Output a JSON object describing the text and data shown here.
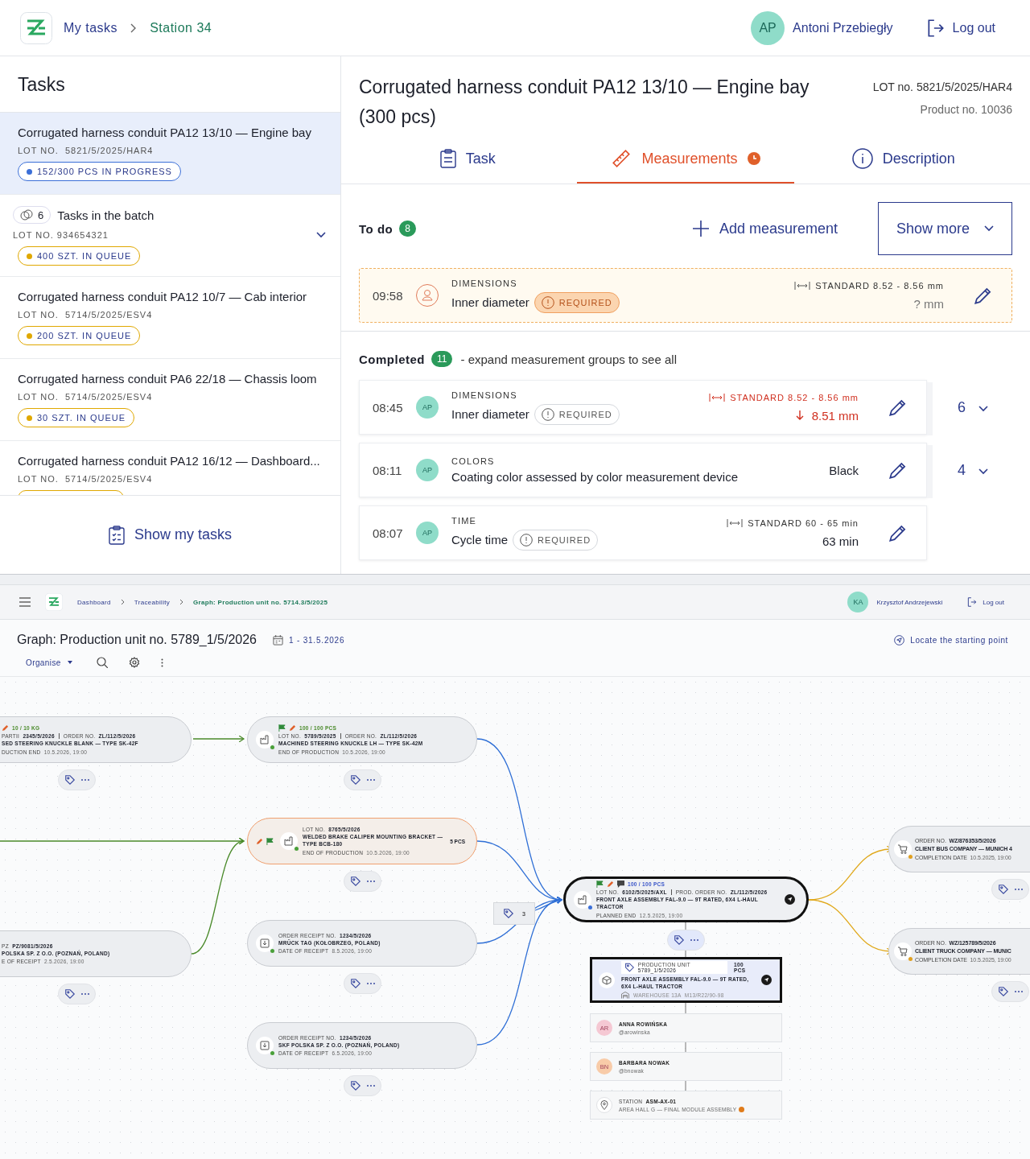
{
  "top": {
    "header": {
      "breadcrumbs": [
        {
          "label": "My tasks",
          "current": false
        },
        {
          "label": "Station 34",
          "current": true
        }
      ],
      "user": {
        "initials": "AP",
        "name": "Antoni Przebiegły"
      },
      "logout": "Log out"
    },
    "tasks_panel": {
      "title": "Tasks",
      "items": [
        {
          "kind": "task",
          "selected": true,
          "title": "Corrugated harness conduit PA12 13/10 — Engine bay",
          "lot_label": "LOT NO.",
          "lot": "5821/5/2025/HAR4",
          "status": "152/300 PCS IN PROGRESS",
          "color": "#3b6fd8"
        },
        {
          "kind": "batch",
          "selected": false,
          "expanded": false,
          "count": "6",
          "title": "Tasks in the batch",
          "lot_label": "LOT NO.",
          "lot": "934654321",
          "status": "400 SZT. IN QUEUE",
          "color": "#e0a800"
        },
        {
          "kind": "task",
          "selected": false,
          "title": "Corrugated harness conduit PA12 10/7 — Cab interior",
          "lot_label": "LOT NO.",
          "lot": "5714/5/2025/ESV4",
          "status": "200 SZT. IN QUEUE",
          "color": "#e0a800"
        },
        {
          "kind": "task",
          "selected": false,
          "title": "Corrugated harness conduit PA6 22/18 — Chassis loom",
          "lot_label": "LOT NO.",
          "lot": "5714/5/2025/ESV4",
          "status": "30 SZT. IN QUEUE",
          "color": "#e0a800"
        },
        {
          "kind": "task",
          "selected": false,
          "title": "Corrugated harness conduit PA12 16/12 — Dashboard...",
          "lot_label": "LOT NO.",
          "lot": "5714/5/2025/ESV4",
          "color": "#e0a800"
        }
      ],
      "show_my_tasks": "Show my tasks"
    },
    "detail": {
      "title": "Corrugated harness conduit PA12 13/10 — Engine bay (300 pcs)",
      "lot_label": "LOT no.",
      "lot": "5821/5/2025/HAR4",
      "product": "Product no. 10036",
      "tabs": [
        {
          "kind": "task",
          "label": "Task",
          "selected": false,
          "alert": false
        },
        {
          "kind": "measure",
          "label": "Measurements",
          "selected": true,
          "alert": true
        },
        {
          "kind": "info",
          "label": "Description",
          "selected": false,
          "alert": false
        }
      ],
      "todo": {
        "label": "To do",
        "count": "8",
        "add": "Add measurement",
        "show_more": "Show more",
        "items": [
          {
            "time": "09:58",
            "group": "DIMENSIONS",
            "name": "Inner diameter",
            "required": {
              "label": "REQUIRED",
              "alert": true
            },
            "standard_label": "STANDARD",
            "standard": "8.52 - 8.56 mm",
            "value": "? mm",
            "out_of_range": false
          }
        ]
      },
      "completed": {
        "label": "Completed",
        "count": "11",
        "hint": "- expand measurement groups to see all",
        "items": [
          {
            "time": "08:45",
            "assignee": "AP",
            "group": "DIMENSIONS",
            "name": "Inner diameter",
            "required": {
              "label": "REQUIRED",
              "alert": false
            },
            "standard_label": "STANDARD",
            "standard": "8.52 - 8.56 mm",
            "value": "8.51 mm",
            "out_of_range": true,
            "count": "6",
            "expanded": false
          },
          {
            "time": "08:11",
            "assignee": "AP",
            "group": "COLORS",
            "name": "Coating color assessed by color measurement device",
            "value": "Black",
            "out_of_range": false,
            "count": "4",
            "expanded": false
          },
          {
            "time": "08:07",
            "assignee": "AP",
            "group": "TIME",
            "name": "Cycle time",
            "required": {
              "label": "REQUIRED",
              "alert": false
            },
            "standard_label": "STANDARD",
            "standard": "60 - 65 min",
            "value": "63 min",
            "out_of_range": false
          }
        ]
      }
    }
  },
  "bottom": {
    "header": {
      "breadcrumbs": [
        {
          "label": "Dashboard",
          "current": false
        },
        {
          "label": "Traceability",
          "current": false
        },
        {
          "label": "Graph: Production unit no. 5714.3/5/2025",
          "current": true
        }
      ],
      "user": {
        "initials": "KA",
        "name": "Krzysztof Andrzejewski"
      },
      "logout": "Log out"
    },
    "title": "Graph: Production unit no. 5789_1/5/2026",
    "date_range": "1 - 31.5.2026",
    "locate": "Locate the starting point",
    "organise": "Organise",
    "graph": {
      "nodes": [
        {
          "kind": "partial",
          "tool": true,
          "quantity": "10 / 10 KG",
          "complete": true,
          "fields": [
            {
              "label": "PARTII",
              "value": "2345/5/2026"
            },
            {
              "label": "ORDER NO.",
              "value": "ZL/112/5/2026"
            }
          ],
          "name": "SED STEERING KNUCKLE BLANK — TYPE SK-42F",
          "date_label": "DUCTION END",
          "date": "10.5.2026, 19:00",
          "highlighted": false,
          "selected": false
        },
        {
          "kind": "production",
          "color": "#4aa03a",
          "flag": true,
          "tool": true,
          "quantity": "100 / 100 PCS",
          "complete": true,
          "fields": [
            {
              "label": "LOT NO.",
              "value": "5789/5/2025"
            },
            {
              "label": "ORDER NO.",
              "value": "ZL/112/5/2026"
            }
          ],
          "name": "MACHINED STEERING KNUCKLE LH — TYPE SK-42M",
          "date_label": "END OF PRODUCTION",
          "date": "10.5.2026, 19:00",
          "highlighted": false,
          "selected": false
        },
        {
          "kind": "production",
          "color": "#4aa03a",
          "flag": true,
          "tool": true,
          "markers_left": true,
          "fields": [
            {
              "label": "LOT NO.",
              "value": "8765/5/2026"
            }
          ],
          "name": "WELDED BRAKE CALIPER MOUNTING BRACKET — TYPE BCB-180",
          "side_quantity": "5 PCS",
          "date_label": "END OF PRODUCTION",
          "date": "10.5.2026, 19:00",
          "highlighted": true,
          "selected": false
        },
        {
          "kind": "partial",
          "fields": [
            {
              "label": "PZ",
              "value": "PZ/9081/5/2026"
            }
          ],
          "name": "POLSKA SP. Z O.O. (POZNAŃ, POLAND)",
          "date_label": "E OF RECEIPT",
          "date": "2.5.2026, 19:00",
          "highlighted": false,
          "selected": false
        },
        {
          "kind": "receipt",
          "color": "#4aa03a",
          "fields": [
            {
              "label": "ORDER RECEIPT NO.",
              "value": "1234/5/2026"
            }
          ],
          "name": "MRÜCK TAG (KOŁOBRZEG, POLAND)",
          "date_label": "DATE OF RECEIPT",
          "date": "8.5.2026, 19:00",
          "highlighted": false,
          "selected": false
        },
        {
          "kind": "receipt",
          "color": "#4aa03a",
          "fields": [
            {
              "label": "ORDER RECEIPT NO.",
              "value": "1234/5/2026"
            }
          ],
          "name": "SKF POLSKA SP. Z O.O. (POZNAŃ, POLAND)",
          "date_label": "DATE OF RECEIPT",
          "date": "6.5.2026, 19:00",
          "highlighted": false,
          "selected": false
        },
        {
          "kind": "production",
          "color": "#3b6fd8",
          "flag": true,
          "tool": true,
          "comment": true,
          "quantity": "100 / 100 PCS",
          "complete": false,
          "fields": [
            {
              "label": "LOT NO.",
              "value": "6102/5/2025/AXL"
            },
            {
              "label": "PROD. ORDER NO.",
              "value": "ZL/112/5/2026"
            }
          ],
          "name": "FRONT AXLE ASSEMBLY FAL-9.0 — 9T RATED, 6X4 L-HAUL TRACTOR",
          "date_label": "PLANNED END",
          "date": "12.5.2025, 19:00",
          "highlighted": false,
          "selected": true
        },
        {
          "kind": "order",
          "color": "#e0a020",
          "fields": [
            {
              "label": "ORDER NO.",
              "value": "WZ/876353/5/2026"
            }
          ],
          "name": "CLIENT BUS COMPANY — MUNICH 4",
          "date_label": "COMPLETION DATE",
          "date": "10.5.2025, 19:00",
          "highlighted": false,
          "selected": false
        },
        {
          "kind": "order",
          "color": "#e0a020",
          "fields": [
            {
              "label": "ORDER NO.",
              "value": "WZ/125789/5/2026"
            }
          ],
          "name": "CLIENT TRUCK COMPANY — MUNIC",
          "date_label": "COMPLETION DATE",
          "date": "10.5.2025, 19:00",
          "highlighted": false,
          "selected": false
        }
      ],
      "tag_group": {
        "count": "3"
      },
      "unit": {
        "label": "PRODUCTION UNIT",
        "value": "5789_1/5/2026",
        "quantity": "100 PCS",
        "name": "FRONT AXLE ASSEMBLY FAL-9.0 — 9T RATED, 6X4 L-HAUL TRACTOR",
        "location_label": "WAREHOUSE 13A",
        "location": "M13/R22/90-98"
      },
      "people": [
        {
          "initials": "AR",
          "name": "ANNA ROWIŃSKA",
          "handle": "@arowinska",
          "color": "#f5c8d3"
        },
        {
          "initials": "BN",
          "name": "BARBARA NOWAK",
          "handle": "@bnowak",
          "color": "#f8cba8"
        }
      ],
      "station": {
        "label": "STATION",
        "value": "ASM-AX-01",
        "area": "AREA HALL G — FINAL MODULE ASSEMBLY",
        "color": "#e07b1a"
      }
    }
  }
}
